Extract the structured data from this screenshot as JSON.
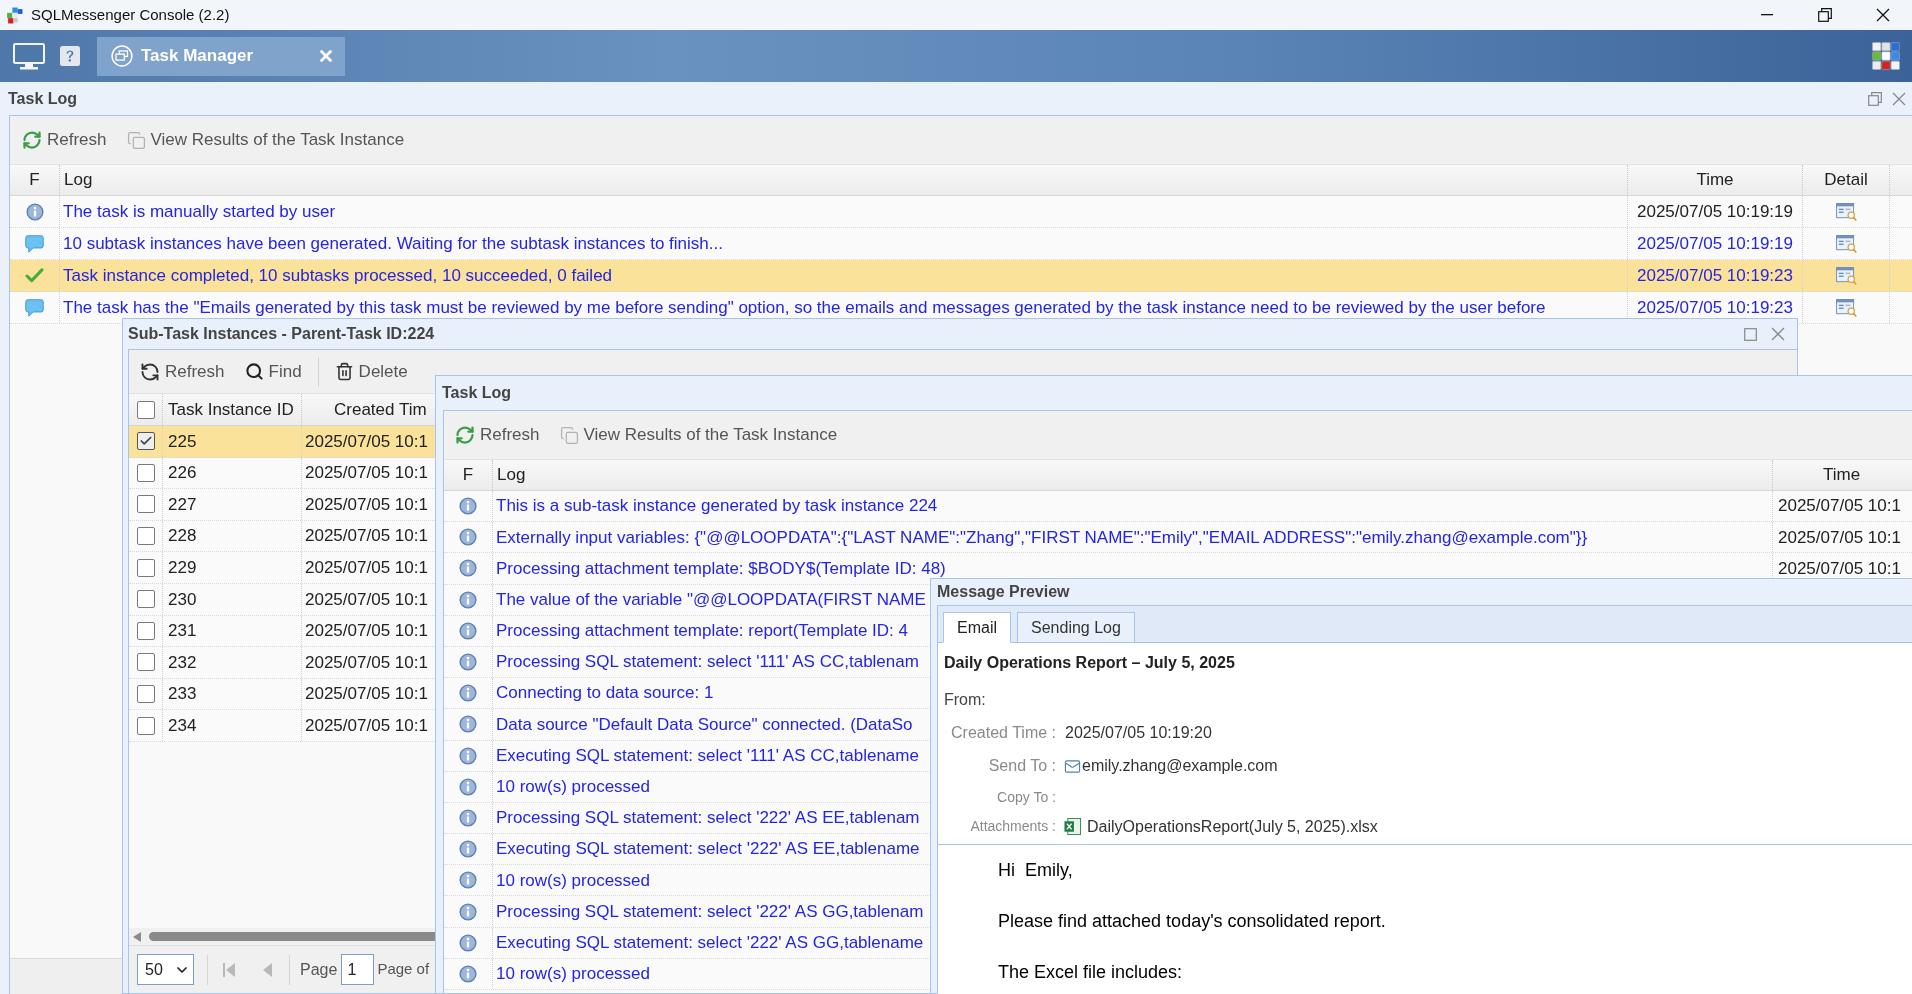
{
  "window": {
    "title": "SQLMessenger Console (2.2)"
  },
  "header_tabs": [
    {
      "label": "Task Manager",
      "selected": true
    }
  ],
  "task_log": {
    "title": "Task Log",
    "toolbar": [
      {
        "kind": "refresh",
        "label": "Refresh"
      },
      {
        "kind": "view",
        "label": "View Results of the Task Instance"
      }
    ],
    "columns": [
      "F",
      "Log",
      "Time",
      "Detail"
    ],
    "rows": [
      {
        "kind": "info",
        "log": "The task is manually started by user",
        "time": {
          "text": "2025/07/05 10:19:19",
          "color": "#222222"
        },
        "selected": false
      },
      {
        "kind": "message",
        "log": "10 subtask instances have been generated. Waiting for the subtask instances to finish...",
        "time": {
          "text": "2025/07/05 10:19:19",
          "color": "#2424e6"
        },
        "selected": false
      },
      {
        "kind": "success",
        "log": "Task instance completed, 10 subtasks processed, 10 succeeded, 0 failed",
        "time": {
          "text": "2025/07/05 10:19:23",
          "color": "#2424e6"
        },
        "selected": true
      },
      {
        "kind": "message",
        "log": "The task has the \"Emails generated by this task must be reviewed by me before sending\" option, so the emails and messages generated by the task instance need to be reviewed by the user before",
        "time": {
          "text": "2025/07/05 10:19:23",
          "color": "#2424e6"
        },
        "selected": false
      }
    ]
  },
  "sub_task_window": {
    "title": "Sub-Task Instances - Parent-Task ID:224",
    "toolbar": [
      {
        "kind": "refresh",
        "label": "Refresh"
      },
      {
        "kind": "find",
        "label": "Find"
      },
      {
        "kind": "delete",
        "label": "Delete"
      }
    ],
    "select_all": {
      "checked": false
    },
    "columns": [
      "Task Instance ID",
      "Created Tim"
    ],
    "rows": [
      {
        "id": "225",
        "created": "2025/07/05 10:1",
        "checked": true,
        "selected": true
      },
      {
        "id": "226",
        "created": "2025/07/05 10:1",
        "checked": false,
        "selected": false
      },
      {
        "id": "227",
        "created": "2025/07/05 10:1",
        "checked": false,
        "selected": false
      },
      {
        "id": "228",
        "created": "2025/07/05 10:1",
        "checked": false,
        "selected": false
      },
      {
        "id": "229",
        "created": "2025/07/05 10:1",
        "checked": false,
        "selected": false
      },
      {
        "id": "230",
        "created": "2025/07/05 10:1",
        "checked": false,
        "selected": false
      },
      {
        "id": "231",
        "created": "2025/07/05 10:1",
        "checked": false,
        "selected": false
      },
      {
        "id": "232",
        "created": "2025/07/05 10:1",
        "checked": false,
        "selected": false
      },
      {
        "id": "233",
        "created": "2025/07/05 10:1",
        "checked": false,
        "selected": false
      },
      {
        "id": "234",
        "created": "2025/07/05 10:1",
        "checked": false,
        "selected": false
      }
    ],
    "pager": {
      "page_size": "50",
      "page_label": "Page",
      "page": "1",
      "page_of": "Page of"
    }
  },
  "sub_log_window": {
    "title": "Task Log",
    "toolbar": [
      {
        "kind": "refresh",
        "label": "Refresh"
      },
      {
        "kind": "view",
        "label": "View Results of the Task Instance"
      }
    ],
    "columns": [
      "F",
      "Log",
      "Time"
    ],
    "rows": [
      {
        "kind": "info",
        "log": "This is a sub-task instance generated by task instance 224",
        "time": "2025/07/05 10:1"
      },
      {
        "kind": "info",
        "log": "Externally input variables: {\"@@LOOPDATA\":{\"LAST NAME\":\"Zhang\",\"FIRST NAME\":\"Emily\",\"EMAIL ADDRESS\":\"emily.zhang@example.com\"}}",
        "time": "2025/07/05 10:1"
      },
      {
        "kind": "info",
        "log": "Processing attachment template: $BODY$(Template ID: 48)",
        "time": "2025/07/05 10:1"
      },
      {
        "kind": "info",
        "log": "The value of the variable \"@@LOOPDATA(FIRST NAME"
      },
      {
        "kind": "info",
        "log": "Processing attachment template: report(Template ID: 4"
      },
      {
        "kind": "info",
        "log": "Processing SQL statement: select '111' AS CC,tablenam"
      },
      {
        "kind": "info",
        "log": "Connecting to data source: 1"
      },
      {
        "kind": "info",
        "log": "Data source \"Default Data Source\" connected. (DataSo"
      },
      {
        "kind": "info",
        "log": "Executing SQL statement: select '111' AS CC,tablename"
      },
      {
        "kind": "info",
        "log": "10 row(s) processed"
      },
      {
        "kind": "info",
        "log": "Processing SQL statement: select '222' AS EE,tablenam"
      },
      {
        "kind": "info",
        "log": "Executing SQL statement: select '222' AS EE,tablename"
      },
      {
        "kind": "info",
        "log": "10 row(s) processed"
      },
      {
        "kind": "info",
        "log": "Processing SQL statement: select '222' AS GG,tablenam"
      },
      {
        "kind": "info",
        "log": "Executing SQL statement: select '222' AS GG,tablename"
      },
      {
        "kind": "info",
        "log": "10 row(s) processed"
      }
    ]
  },
  "message_preview": {
    "title": "Message Preview",
    "tabs": [
      {
        "label": "Email",
        "selected": true
      },
      {
        "label": "Sending Log",
        "selected": false
      }
    ],
    "subject": "Daily Operations Report – July 5, 2025",
    "from_label": "From:",
    "fields": [
      {
        "kind": "text",
        "label": "Created Time :",
        "value": "2025/07/05 10:19:20"
      },
      {
        "kind": "email",
        "label": "Send To :",
        "value": "emily.zhang@example.com"
      },
      {
        "kind": "empty",
        "label": "Copy To :"
      },
      {
        "kind": "attachment",
        "label": "Attachments :",
        "value": "DailyOperationsReport(July 5, 2025).xlsx"
      }
    ],
    "body": [
      "Hi  Emily,",
      "Please find attached today's consolidated report.",
      "The Excel file includes:"
    ]
  }
}
